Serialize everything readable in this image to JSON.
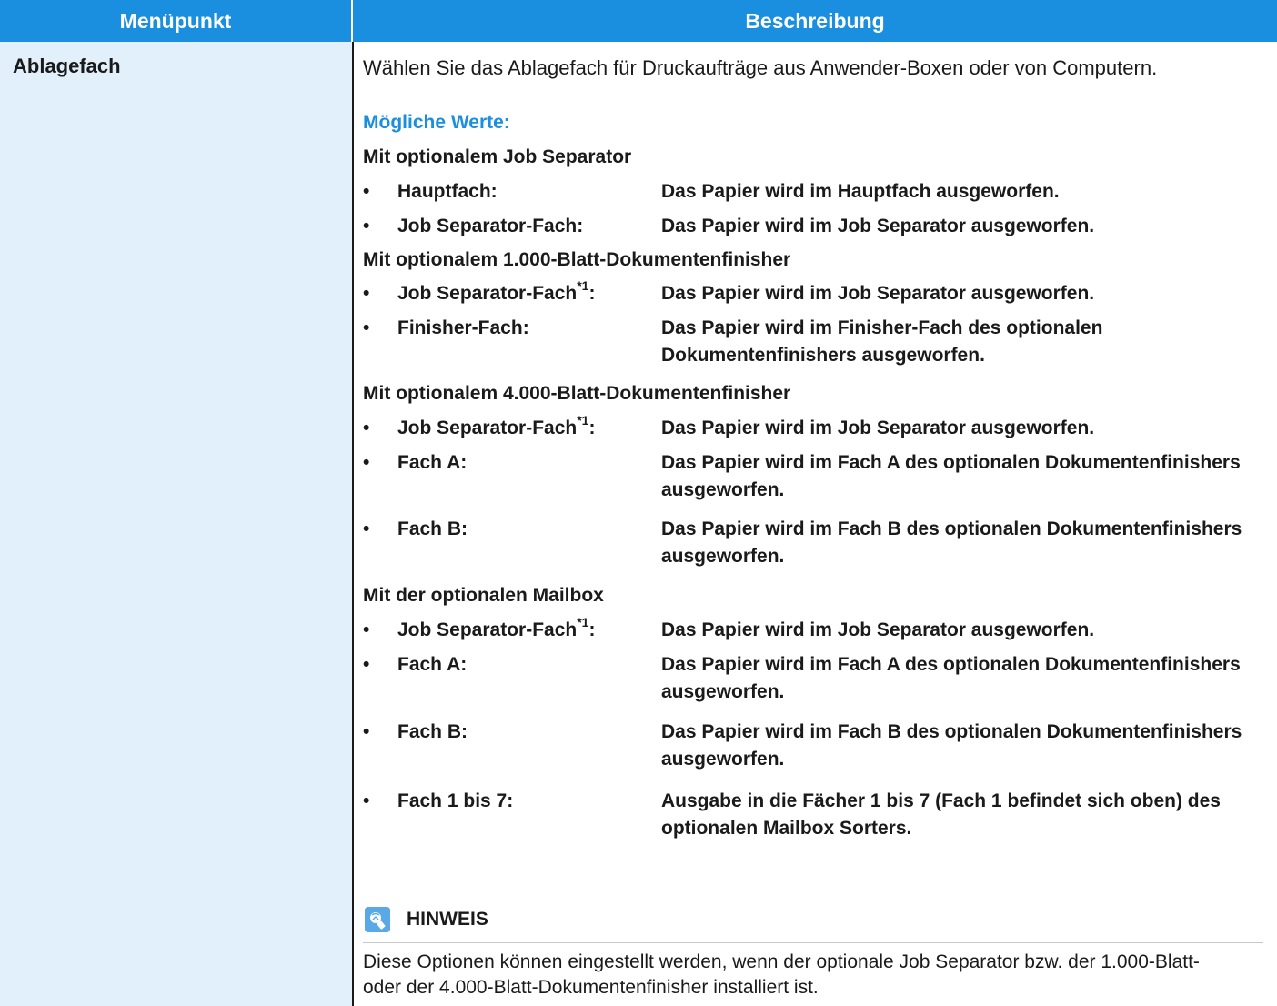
{
  "header": {
    "col1": "Menüpunkt",
    "col2": "Beschreibung"
  },
  "item": {
    "label": "Ablagefach"
  },
  "intro": "Wählen Sie das Ablagefach für Druckaufträge aus Anwender-Boxen oder von Computern.",
  "possible_values": "Mögliche Werte:",
  "groups": [
    {
      "title": "Mit optionalem Job Separator",
      "options": [
        {
          "name": "Hauptfach:",
          "text": "Das Papier wird im Hauptfach ausgeworfen."
        },
        {
          "name": "Job Separator-Fach:",
          "text": "Das Papier wird im Job Separator ausgeworfen."
        }
      ]
    },
    {
      "title": "Mit optionalem 1.000-Blatt-Dokumentenfinisher",
      "options": [
        {
          "name": "Job Separator-Fach",
          "sup": "*1",
          "colon": ":",
          "text": "Das Papier wird im Job Separator ausgeworfen."
        },
        {
          "name": "Finisher-Fach:",
          "text": "Das Papier wird im Finisher-Fach des optionalen Dokumentenfinishers ausgeworfen."
        }
      ]
    },
    {
      "title": "Mit optionalem 4.000-Blatt-Dokumentenfinisher",
      "options": [
        {
          "name": "Job Separator-Fach",
          "sup": "*1",
          "colon": ":",
          "text": "Das Papier wird im Job Separator ausgeworfen."
        },
        {
          "name": "Fach A:",
          "text": "Das Papier wird im Fach A des optionalen Dokumentenfinishers ausgeworfen."
        },
        {
          "name": "Fach B:",
          "text": "Das Papier wird im Fach B des optionalen Dokumentenfinishers ausgeworfen."
        }
      ]
    },
    {
      "title": "Mit der optionalen Mailbox",
      "options": [
        {
          "name": "Job Separator-Fach",
          "sup": "*1",
          "colon": ":",
          "text": "Das Papier wird im Job Separator ausgeworfen."
        },
        {
          "name": "Fach A:",
          "text": "Das Papier wird im Fach A des optionalen Dokumentenfinishers ausgeworfen."
        },
        {
          "name": "Fach B:",
          "text": "Das Papier wird im Fach B des optionalen Dokumentenfinishers ausgeworfen."
        },
        {
          "name": "Fach 1 bis 7:",
          "text": "Ausgabe in die Fächer 1 bis 7 (Fach 1 befindet sich oben) des optionalen Mailbox Sorters."
        }
      ]
    }
  ],
  "bullet": "•",
  "note": {
    "icon": "note-icon",
    "title": "HINWEIS",
    "text": "Diese Optionen können eingestellt werden, wenn der optionale Job Separator bzw. der 1.000-Blatt- oder der 4.000-Blatt-Dokumentenfinisher installiert ist."
  },
  "colors": {
    "header": "#1a8fe0",
    "column": "#e1f0fb",
    "accent": "#1a8fe0"
  }
}
